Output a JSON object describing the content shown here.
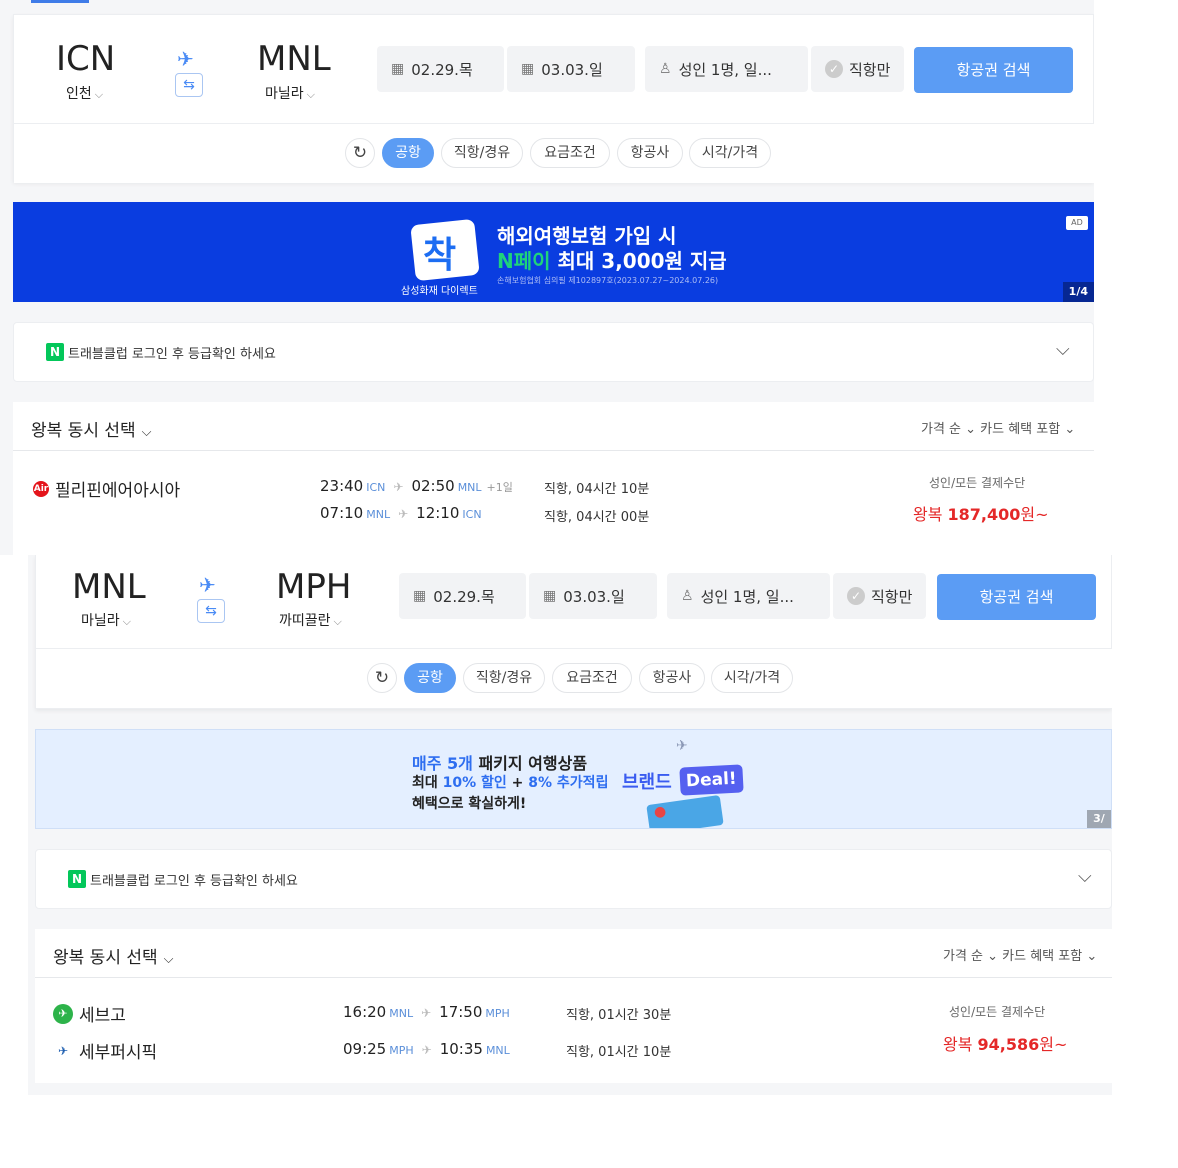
{
  "screens": [
    {
      "departure": {
        "code": "ICN",
        "city": "인천"
      },
      "arrival": {
        "code": "MNL",
        "city": "마닐라"
      },
      "depart_date": "02.29.목",
      "return_date": "03.03.일",
      "passengers": "성인 1명, 일...",
      "direct_only": "직항만",
      "search_button": "항공권 검색",
      "filters": [
        "공항",
        "직항/경유",
        "요금조건",
        "항공사",
        "시각/가격"
      ],
      "ad": {
        "brand_glyph": "착",
        "brand_name": "삼성화재 다이렉트",
        "line1": "해외여행보험 가입 시",
        "line2_highlight": "N페이",
        "line2_rest": " 최대 3,000원 지급",
        "line3": "손해보험협회 심의필 제102897호(2023.07.27~2024.07.26)",
        "badge": "AD",
        "counter": "1/4"
      },
      "login": {
        "badge": "N",
        "text": "트래블클럽 로그인 후 등급확인 하세요"
      },
      "results": {
        "title": "왕복 동시 선택",
        "sort": "가격 순 ⌄   카드 혜택 포함 ⌄",
        "airlines": [
          {
            "name": "필리핀에어아시아",
            "logo_color": "#e4141b",
            "logo_text": "Air"
          }
        ],
        "legs": [
          {
            "dep_time": "23:40",
            "dep_ap": "ICN",
            "arr_time": "02:50",
            "arr_ap": "MNL",
            "plus": "+1일",
            "duration": "직항, 04시간 10분"
          },
          {
            "dep_time": "07:10",
            "dep_ap": "MNL",
            "arr_time": "12:10",
            "arr_ap": "ICN",
            "plus": "",
            "duration": "직항, 04시간 00분"
          }
        ],
        "payment": "성인/모든 결제수단",
        "price_prefix": "왕복 ",
        "price": "187,400",
        "price_suffix": "원~"
      }
    },
    {
      "departure": {
        "code": "MNL",
        "city": "마닐라"
      },
      "arrival": {
        "code": "MPH",
        "city": "까띠끌란"
      },
      "depart_date": "02.29.목",
      "return_date": "03.03.일",
      "passengers": "성인 1명, 일...",
      "direct_only": "직항만",
      "search_button": "항공권 검색",
      "filters": [
        "공항",
        "직항/경유",
        "요금조건",
        "항공사",
        "시각/가격"
      ],
      "ad": {
        "l1_blue": "매주 5개",
        "l1_rest": " 패키지 여행상품",
        "l2_a": "최대 ",
        "l2_blue1": "10% 할인",
        "l2_b": " + ",
        "l2_blue2": "8% 추가적립",
        "l3": "혜택으로 확실하게!",
        "brand": "브랜드",
        "deal": "Deal!",
        "counter": "3/"
      },
      "login": {
        "badge": "N",
        "text": "트래블클럽 로그인 후 등급확인 하세요"
      },
      "results": {
        "title": "왕복 동시 선택",
        "sort": "가격 순 ⌄   카드 혜택 포함 ⌄",
        "airlines": [
          {
            "name": "세브고",
            "logo_color": "#2db34a",
            "logo_text": "✈"
          },
          {
            "name": "세부퍼시픽",
            "logo_color": "#ffffff",
            "logo_text": "✈"
          }
        ],
        "legs": [
          {
            "dep_time": "16:20",
            "dep_ap": "MNL",
            "arr_time": "17:50",
            "arr_ap": "MPH",
            "plus": "",
            "duration": "직항, 01시간 30분"
          },
          {
            "dep_time": "09:25",
            "dep_ap": "MPH",
            "arr_time": "10:35",
            "arr_ap": "MNL",
            "plus": "",
            "duration": "직항, 01시간 10분"
          }
        ],
        "payment": "성인/모든 결제수단",
        "price_prefix": "왕복 ",
        "price": "94,586",
        "price_suffix": "원~"
      }
    }
  ]
}
